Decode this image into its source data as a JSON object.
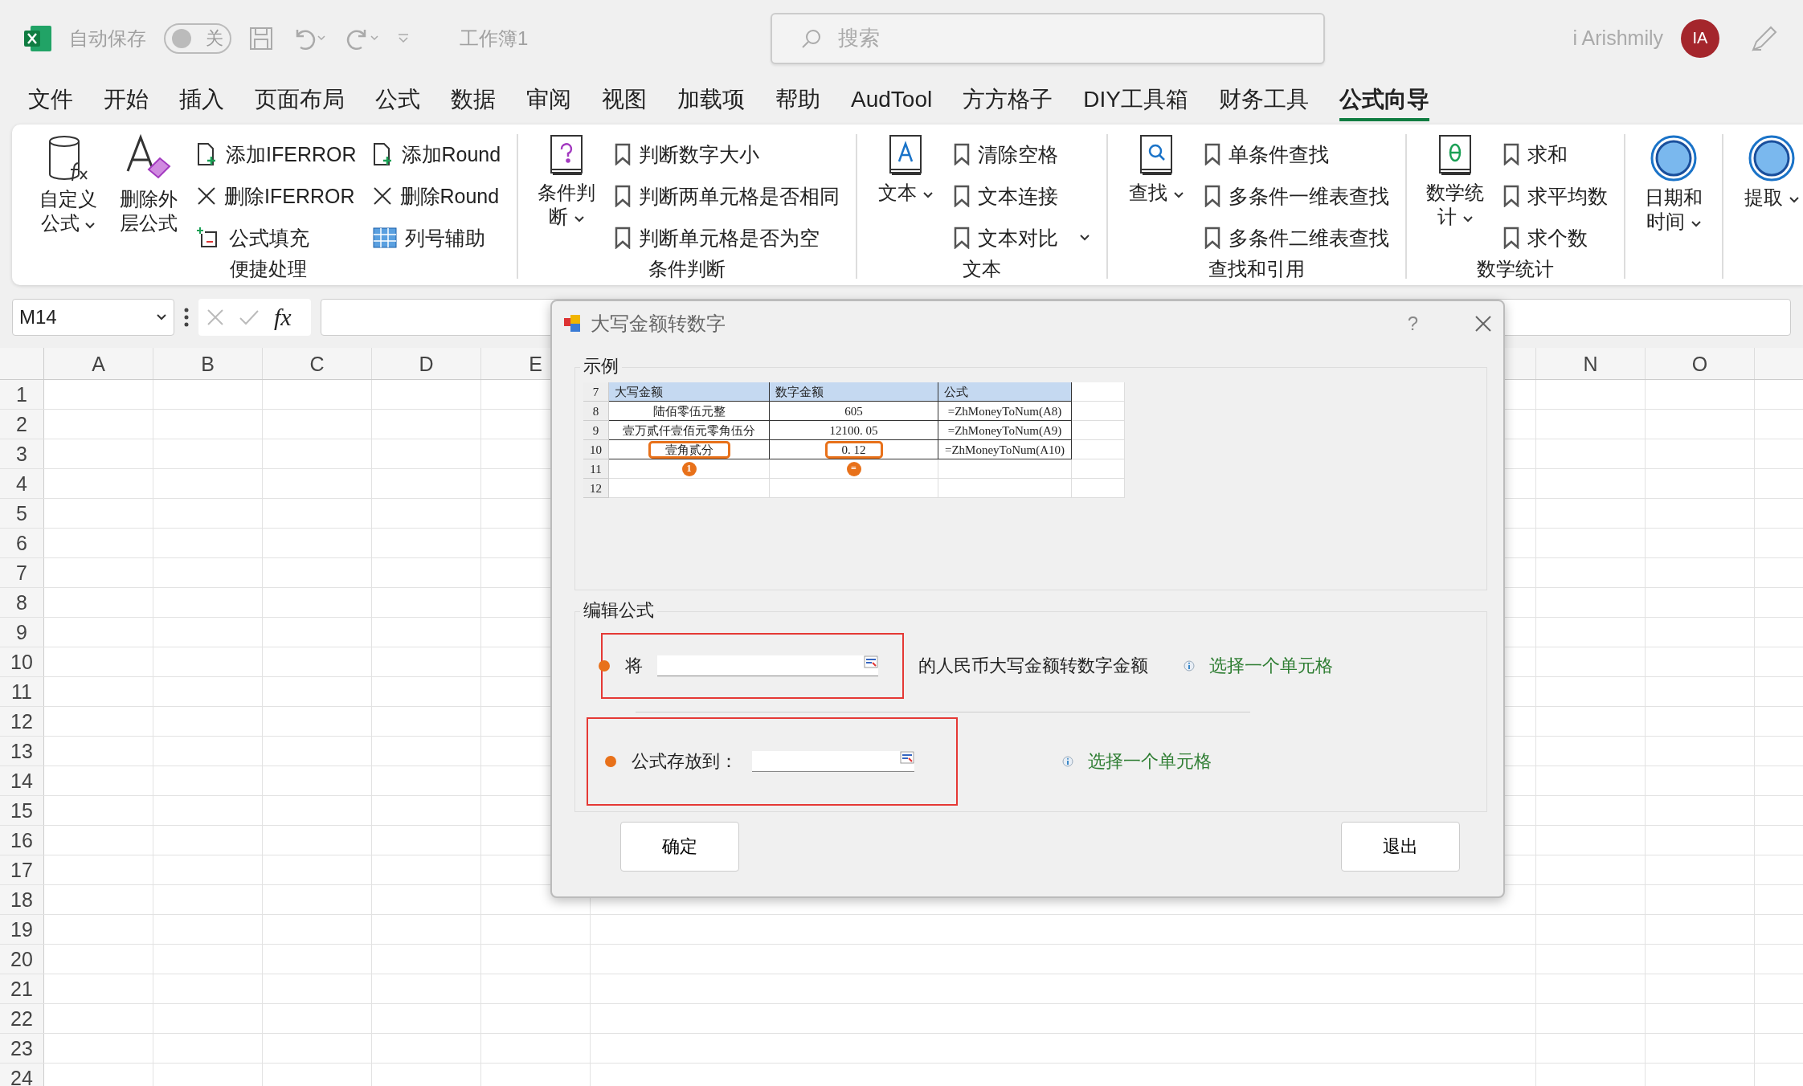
{
  "title_bar": {
    "autosave_label": "自动保存",
    "autosave": {
      "on": false,
      "label": "关"
    },
    "workbook": "工作簿1",
    "search_placeholder": "搜索",
    "user": "i Arishmily",
    "avatar": "IA"
  },
  "menu_tabs": [
    {
      "label": "文件",
      "selected": false
    },
    {
      "label": "开始",
      "selected": false
    },
    {
      "label": "插入",
      "selected": false
    },
    {
      "label": "页面布局",
      "selected": false
    },
    {
      "label": "公式",
      "selected": false
    },
    {
      "label": "数据",
      "selected": false
    },
    {
      "label": "审阅",
      "selected": false
    },
    {
      "label": "视图",
      "selected": false
    },
    {
      "label": "加载项",
      "selected": false
    },
    {
      "label": "帮助",
      "selected": false
    },
    {
      "label": "AudTool",
      "selected": false
    },
    {
      "label": "方方格子",
      "selected": false
    },
    {
      "label": "DIY工具箱",
      "selected": false
    },
    {
      "label": "财务工具",
      "selected": false
    },
    {
      "label": "公式向导",
      "selected": true
    }
  ],
  "ribbon_groups": [
    {
      "label": "便捷处理",
      "large": [
        {
          "label": "自定义公式",
          "kind": "formula",
          "dropdown": true
        },
        {
          "label": "删除外层公式",
          "kind": "eraser",
          "dropdown": false
        }
      ],
      "small_columns": [
        [
          {
            "label": "添加IFERROR",
            "kind": "add"
          },
          {
            "label": "删除IFERROR",
            "kind": "remove"
          },
          {
            "label": "公式填充",
            "kind": "fill"
          }
        ],
        [
          {
            "label": "添加Round",
            "kind": "add"
          },
          {
            "label": "删除Round",
            "kind": "remove"
          },
          {
            "label": "列号辅助",
            "kind": "columns"
          }
        ]
      ]
    },
    {
      "label": "条件判断",
      "large": [
        {
          "label": "条件判断",
          "kind": "question",
          "dropdown": true
        }
      ],
      "small_columns": [
        [
          {
            "label": "判断数字大小",
            "kind": "bookmark"
          },
          {
            "label": "判断两单元格是否相同",
            "kind": "bookmark"
          },
          {
            "label": "判断单元格是否为空",
            "kind": "bookmark"
          }
        ]
      ]
    },
    {
      "label": "文本",
      "large": [
        {
          "label": "文本",
          "kind": "letter",
          "dropdown": true
        }
      ],
      "small_columns": [
        [
          {
            "label": "清除空格",
            "kind": "bookmark"
          },
          {
            "label": "文本连接",
            "kind": "bookmark"
          },
          {
            "label": "文本对比",
            "kind": "bookmark",
            "dropdown": true
          }
        ]
      ]
    },
    {
      "label": "查找和引用",
      "large": [
        {
          "label": "查找",
          "kind": "search",
          "dropdown": true
        }
      ],
      "small_columns": [
        [
          {
            "label": "单条件查找",
            "kind": "bookmark"
          },
          {
            "label": "多条件一维表查找",
            "kind": "bookmark"
          },
          {
            "label": "多条件二维表查找",
            "kind": "bookmark"
          }
        ]
      ]
    },
    {
      "label": "数学统计",
      "large": [
        {
          "label": "数学统计",
          "kind": "theta",
          "dropdown": true
        }
      ],
      "small_columns": [
        [
          {
            "label": "求和",
            "kind": "bookmark"
          },
          {
            "label": "求平均数",
            "kind": "bookmark"
          },
          {
            "label": "求个数",
            "kind": "bookmark"
          }
        ]
      ]
    },
    {
      "large": [
        {
          "label": "日期和时间",
          "kind": "circle",
          "dropdown": true
        }
      ]
    },
    {
      "large": [
        {
          "label": "提取",
          "kind": "circle",
          "dropdown": true
        }
      ]
    }
  ],
  "formula_bar": {
    "name_box": "M14",
    "fx": "fx"
  },
  "sheet": {
    "columns_left": [
      "A",
      "B",
      "C",
      "D",
      "E"
    ],
    "columns_right": [
      "N",
      "O"
    ],
    "rows": [
      "1",
      "2",
      "3",
      "4",
      "5",
      "6",
      "7",
      "8",
      "9",
      "10",
      "11",
      "12",
      "13",
      "14",
      "15",
      "16",
      "17",
      "18",
      "19",
      "20",
      "21",
      "22",
      "23",
      "24"
    ]
  },
  "dialog": {
    "title": "大写金额转数字",
    "help": "?",
    "example_label": "示例",
    "example_rows": [
      {
        "num": "7",
        "kind": "header",
        "cells": [
          {
            "text": "大写金额",
            "circled": false
          },
          {
            "text": "数字金额",
            "circled": false
          },
          {
            "text": "公式",
            "circled": false
          }
        ]
      },
      {
        "num": "8",
        "kind": "data",
        "cells": [
          {
            "text": "陆佰零伍元整",
            "circled": false
          },
          {
            "text": "605",
            "circled": false
          },
          {
            "text": "=ZhMoneyToNum(A8)",
            "circled": false
          }
        ]
      },
      {
        "num": "9",
        "kind": "data",
        "cells": [
          {
            "text": "壹万贰仟壹佰元零角伍分",
            "circled": false
          },
          {
            "text": "12100. 05",
            "circled": false
          },
          {
            "text": "=ZhMoneyToNum(A9)",
            "circled": false
          }
        ]
      },
      {
        "num": "10",
        "kind": "data",
        "cells": [
          {
            "text": "壹角贰分",
            "circled": true
          },
          {
            "text": "0. 12",
            "circled": true
          },
          {
            "text": "=ZhMoneyToNum(A10)",
            "circled": false
          }
        ]
      },
      {
        "num": "11",
        "kind": "data",
        "cells": [
          {
            "badge": "1"
          },
          {
            "badge": "="
          },
          {}
        ]
      },
      {
        "num": "12",
        "kind": "data",
        "cells": [
          {},
          {},
          {}
        ]
      }
    ],
    "edit_label": "编辑公式",
    "source": {
      "prefix": "将",
      "suffix": "的人民币大写金额转数字金额",
      "link": "选择一个单元格"
    },
    "target": {
      "label": "公式存放到：",
      "link": "选择一个单元格"
    },
    "buttons": [
      "确定",
      "退出"
    ]
  }
}
